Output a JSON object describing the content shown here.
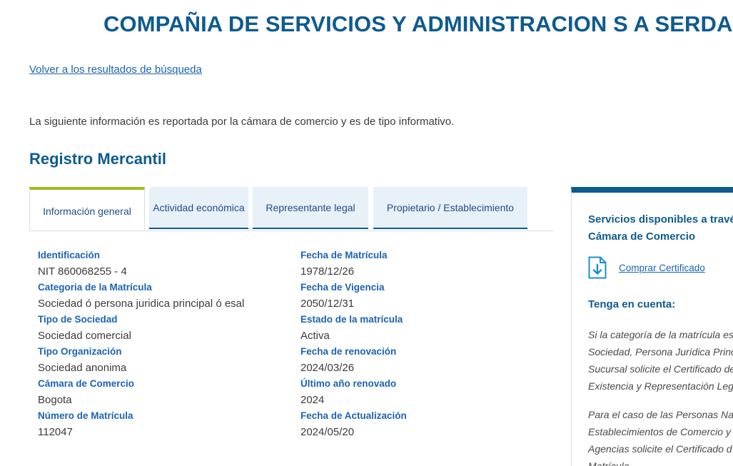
{
  "page": {
    "title": "COMPAÑIA DE SERVICIOS Y ADMINISTRACION S A SERDAN S A",
    "back_link": "Volver a los resultados de búsqueda",
    "info_text": "La siguiente información es reportada por la cámara de comercio y es de tipo informativo.",
    "section_title": "Registro Mercantil"
  },
  "tabs": [
    {
      "label": "Información general",
      "active": true
    },
    {
      "label": "Actividad económica",
      "active": false
    },
    {
      "label": "Representante legal",
      "active": false
    },
    {
      "label": "Propietario / Establecimiento",
      "active": false
    }
  ],
  "general_info": {
    "left": [
      {
        "label": "Identificación",
        "value": "NIT 860068255 - 4"
      },
      {
        "label": "Categoria de la Matrícula",
        "value": "Sociedad ó persona juridica principal ó esal"
      },
      {
        "label": "Tipo de Sociedad",
        "value": "Sociedad comercial"
      },
      {
        "label": "Tipo Organización",
        "value": "Sociedad anonima"
      },
      {
        "label": "Cámara de Comercio",
        "value": "Bogota"
      },
      {
        "label": "Número de Matrícula",
        "value": "112047"
      }
    ],
    "right": [
      {
        "label": "Fecha de Matrícula",
        "value": "1978/12/26"
      },
      {
        "label": "Fecha de Vigencia",
        "value": "2050/12/31"
      },
      {
        "label": "Estado de la matrícula",
        "value": "Activa"
      },
      {
        "label": "Fecha de renovación",
        "value": "2024/03/26"
      },
      {
        "label": "Último año renovado",
        "value": "2024"
      },
      {
        "label": "Fecha de Actualización",
        "value": "2024/05/20"
      }
    ]
  },
  "sidebar": {
    "heading": "Servicios disponibles a travé\nCámara de Comercio",
    "cert_link": "Comprar Certificado",
    "cert_icon": "download-document-icon",
    "note_heading": "Tenga en cuenta:",
    "note_1": "Si la categoría de la matrícula es\nSociedad, Persona Jurídica Princi\nSucursal solicite el Certificado de\nExistencia y Representación Leg",
    "note_2": "Para el caso de las Personas Na\nEstablecimientos de Comercio y\nAgencias solicite el Certificado d\nMatrícula."
  },
  "colors": {
    "primary": "#0e5b8f",
    "link": "#1a64b4",
    "active_tab_accent": "#9ebd1e",
    "tab_bg": "#e8f0f8"
  }
}
